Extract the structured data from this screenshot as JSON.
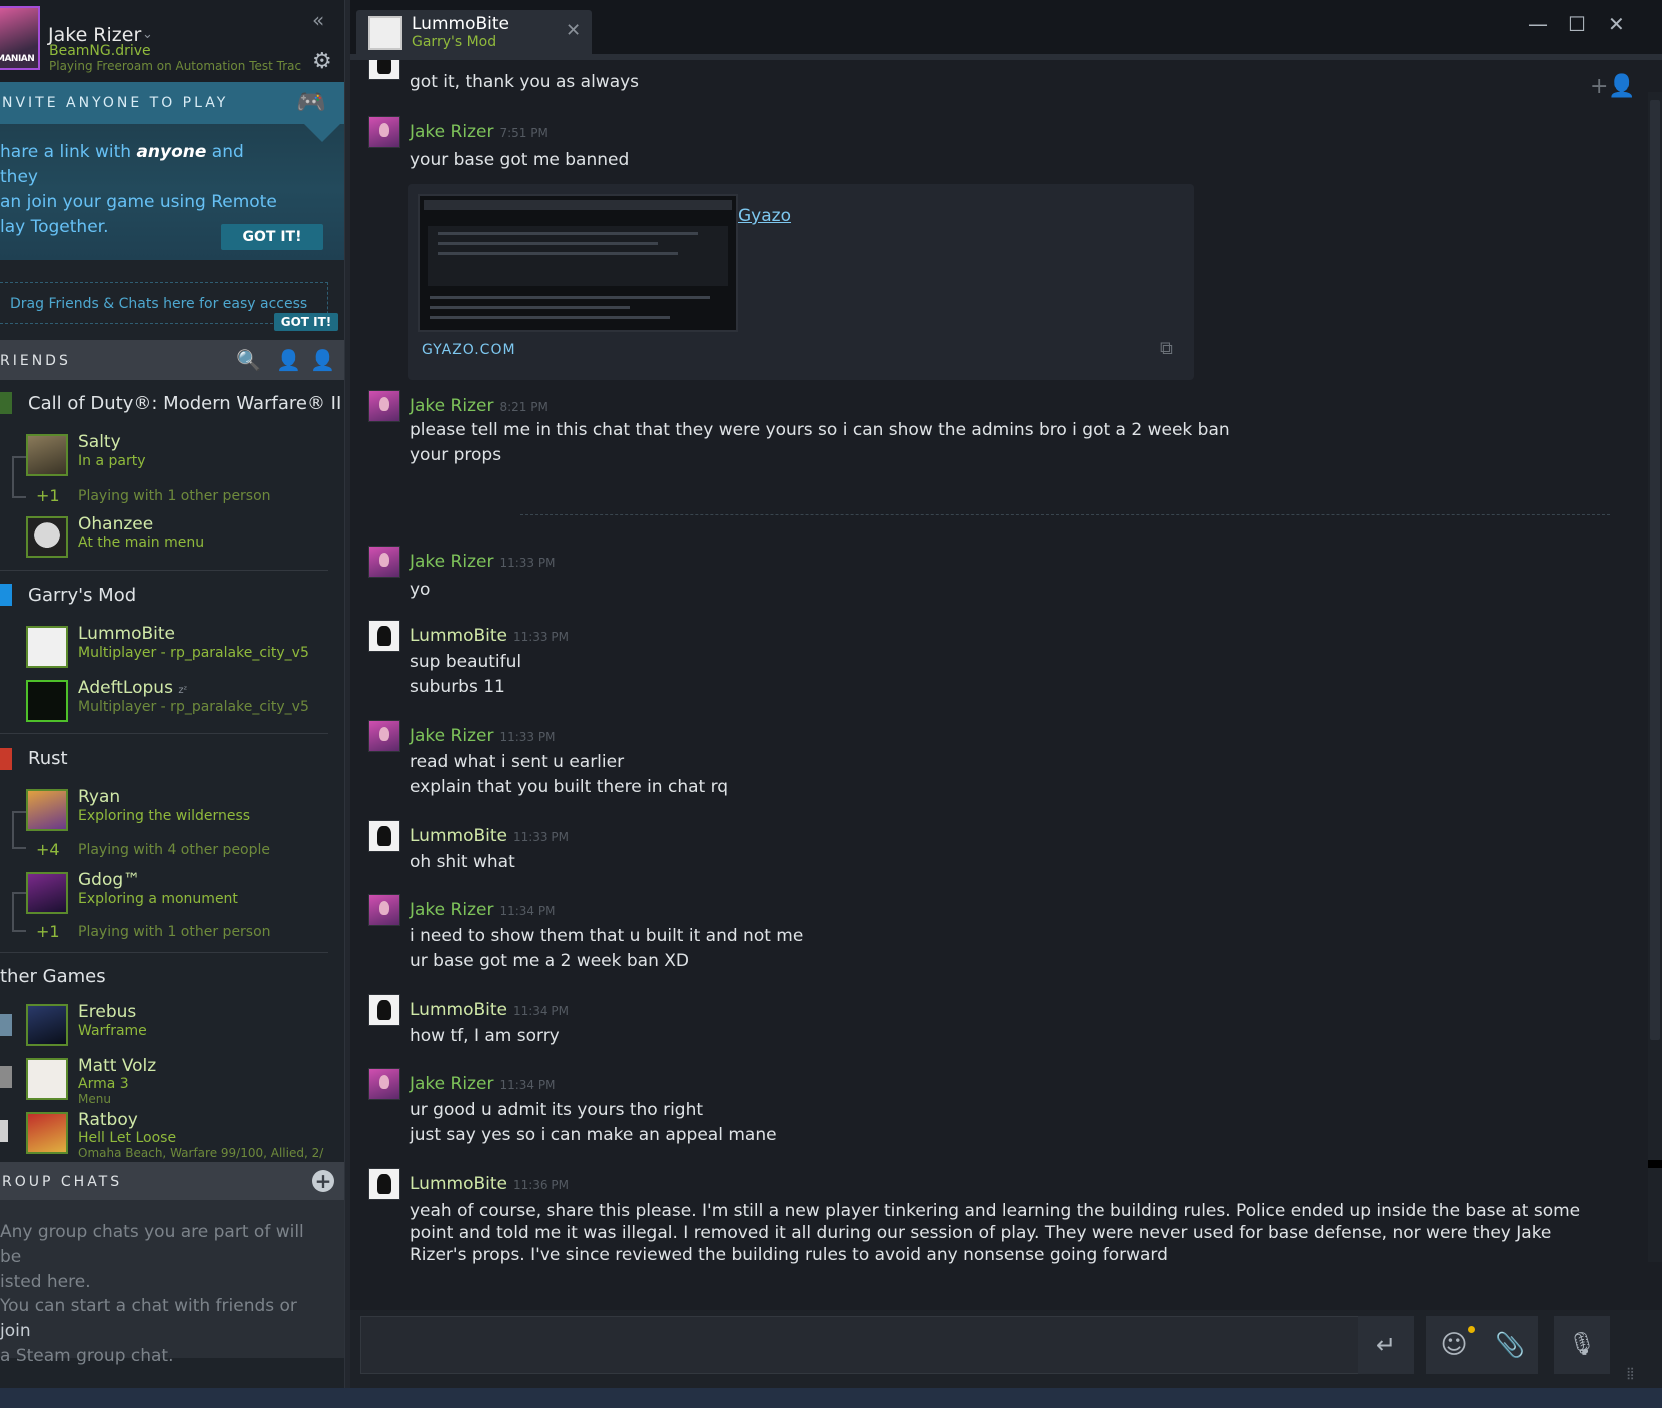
{
  "profile": {
    "name": "Jake Rizer",
    "game": "BeamNG.drive",
    "rich_presence": "Playing Freeroam on Automation Test Track"
  },
  "invite": {
    "title": "NVITE ANYONE TO PLAY",
    "body_pre": "hare a link with ",
    "body_em": "anyone",
    "body_post": " and they an join your game using Remote lay Together.",
    "line1_pre": "hare a link with ",
    "line1_em": "anyone",
    "line1_post": " and they",
    "line2": "an join your game using Remote",
    "line3": "lay Together.",
    "button": "GOT IT!"
  },
  "drag": {
    "text": "Drag Friends & Chats here for easy access",
    "button": "GOT IT!"
  },
  "friends_header": {
    "title": "RIENDS"
  },
  "groups": [
    {
      "title": "Call of Duty®: Modern Warfare® II | '",
      "friends": [
        {
          "name": "Salty",
          "status": "In a party"
        },
        {
          "name": "Ohanzee",
          "status": "At the main menu"
        }
      ],
      "party": {
        "plus": "+1",
        "text": "Playing with 1 other person"
      }
    },
    {
      "title": "Garry's Mod",
      "friends": [
        {
          "name": "LummoBite",
          "status": "Multiplayer - rp_paralake_city_v5"
        },
        {
          "name": "AdeftLopus",
          "sleep": "zᶻ",
          "status": "Multiplayer - rp_paralake_city_v5"
        }
      ]
    },
    {
      "title": "Rust",
      "friends": [
        {
          "name": "Ryan",
          "status": "Exploring the wilderness"
        },
        {
          "name": "Gdog™",
          "status": "Exploring a monument"
        }
      ],
      "party1": {
        "plus": "+4",
        "text": "Playing with 4 other people"
      },
      "party2": {
        "plus": "+1",
        "text": "Playing with 1 other person"
      }
    },
    {
      "title": "ther Games",
      "friends": [
        {
          "name": "Erebus",
          "status": "Warframe"
        },
        {
          "name": "Matt Volz",
          "status": "Arma 3",
          "sub": "Menu"
        },
        {
          "name": "Ratboy",
          "status": "Hell Let Loose",
          "sub": "Omaha Beach, Warfare 99/100, Allied, 2/"
        }
      ]
    }
  ],
  "group_chats": {
    "title": "ROUP CHATS",
    "line1": "Any group chats you are part of will be",
    "line2": "isted here.",
    "line3_pre": "You can start a chat with friends or ",
    "line3_link": "join",
    "line4": "a Steam group chat."
  },
  "chat_tab": {
    "name": "LummoBite",
    "game": "Garry's Mod"
  },
  "messages": [
    {
      "author": "LummoBite",
      "time": "",
      "lines": [
        "got it, thank you as always"
      ]
    },
    {
      "author": "Jake Rizer",
      "time": "7:51 PM",
      "lines": [
        "your base got me banned"
      ]
    },
    {
      "author": "Jake Rizer",
      "time": "8:21 PM",
      "lines": [
        "please tell me in this chat that they were yours so i can show the admins bro i got a 2 week ban",
        "your props"
      ]
    },
    {
      "author": "Jake Rizer",
      "time": "11:33 PM",
      "lines": [
        "yo"
      ]
    },
    {
      "author": "LummoBite",
      "time": "11:33 PM",
      "lines": [
        "sup beautiful",
        "suburbs 11"
      ]
    },
    {
      "author": "Jake Rizer",
      "time": "11:33 PM",
      "lines": [
        "read what i sent u earlier",
        "explain that you built there in chat rq"
      ]
    },
    {
      "author": "LummoBite",
      "time": "11:33 PM",
      "lines": [
        "oh shit what"
      ]
    },
    {
      "author": "Jake Rizer",
      "time": "11:34 PM",
      "lines": [
        "i need to show them that u built it and not me",
        "ur base got me a 2 week ban XD"
      ]
    },
    {
      "author": "LummoBite",
      "time": "11:34 PM",
      "lines": [
        "how tf, I am sorry"
      ]
    },
    {
      "author": "Jake Rizer",
      "time": "11:34 PM",
      "lines": [
        "ur good u admit its yours tho right",
        "just say yes so i can make an appeal mane"
      ]
    },
    {
      "author": "LummoBite",
      "time": "11:36 PM",
      "text": "yeah of course, share this please. I'm still a new player tinkering and learning the building rules. Police ended up inside the base at some point and told me it was illegal. I removed it all during our session of play. They were never used for base defense, nor were they Jake Rizer's props. I've since reviewed the building rules to avoid any nonsense going forward"
    }
  ],
  "embed": {
    "title": "Gyazo",
    "domain": "GYAZO.COM"
  },
  "colors": {
    "accent": "#67c1f5",
    "ingame": "#90ba3c",
    "bg": "#1b1e24"
  }
}
